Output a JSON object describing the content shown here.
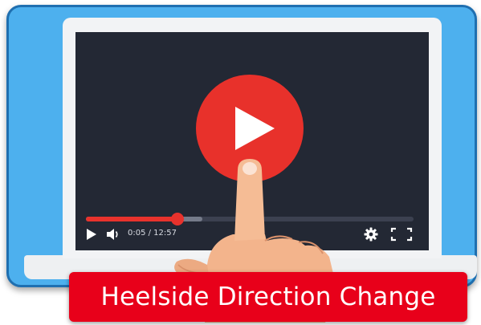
{
  "video": {
    "current_time": "0:05",
    "duration": "12:57",
    "time_display": "0:05 / 12:57",
    "progress_fraction": 0.28
  },
  "banner": {
    "title": "Heelside Direction Change"
  },
  "colors": {
    "frame_blue": "#4db0ee",
    "accent_red": "#e8312b",
    "banner_red": "#e8001a",
    "video_bg": "#232834"
  },
  "icons": {
    "big_play": "play-icon",
    "play": "play-icon",
    "volume": "volume-icon",
    "settings": "gear-icon",
    "fullscreen": "fullscreen-icon",
    "hand": "pointing-hand-icon"
  }
}
